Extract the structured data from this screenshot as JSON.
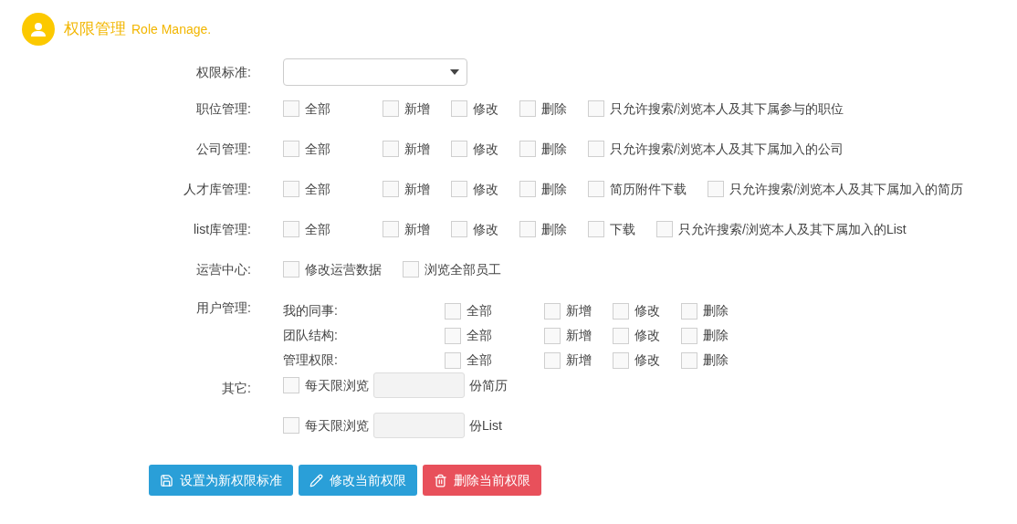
{
  "header": {
    "title": "权限管理",
    "subtitle": "Role Manage."
  },
  "standard": {
    "label": "权限标准:"
  },
  "rows": [
    {
      "kind": "options",
      "label": "职位管理:",
      "options": [
        {
          "label": "全部",
          "checked": false
        },
        {
          "label": "新增",
          "checked": false
        },
        {
          "label": "修改",
          "checked": false
        },
        {
          "label": "删除",
          "checked": false
        },
        {
          "label": "只允许搜索/浏览本人及其下属参与的职位",
          "checked": false
        }
      ]
    },
    {
      "kind": "options",
      "label": "公司管理:",
      "options": [
        {
          "label": "全部",
          "checked": false
        },
        {
          "label": "新增",
          "checked": false
        },
        {
          "label": "修改",
          "checked": false
        },
        {
          "label": "删除",
          "checked": false
        },
        {
          "label": "只允许搜索/浏览本人及其下属加入的公司",
          "checked": false
        }
      ]
    },
    {
      "kind": "options",
      "label": "人才库管理:",
      "options": [
        {
          "label": "全部",
          "checked": false
        },
        {
          "label": "新增",
          "checked": false
        },
        {
          "label": "修改",
          "checked": false
        },
        {
          "label": "删除",
          "checked": false
        },
        {
          "label": "简历附件下载",
          "checked": false
        },
        {
          "label": "只允许搜索/浏览本人及其下属加入的简历",
          "checked": false
        }
      ]
    },
    {
      "kind": "options",
      "label": "list库管理:",
      "options": [
        {
          "label": "全部",
          "checked": false
        },
        {
          "label": "新增",
          "checked": false
        },
        {
          "label": "修改",
          "checked": false
        },
        {
          "label": "删除",
          "checked": false
        },
        {
          "label": "下载",
          "checked": false
        },
        {
          "label": "只允许搜索/浏览本人及其下属加入的List",
          "checked": false
        }
      ]
    },
    {
      "kind": "plain",
      "label": "运营中心:",
      "options": [
        {
          "label": "修改运营数据",
          "checked": false
        },
        {
          "label": "浏览全部员工",
          "checked": false
        }
      ]
    },
    {
      "kind": "nested",
      "label": "用户管理:",
      "groups": [
        {
          "label": "我的同事:",
          "options": [
            {
              "label": "全部",
              "checked": false
            },
            {
              "label": "新增",
              "checked": false
            },
            {
              "label": "修改",
              "checked": false
            },
            {
              "label": "删除",
              "checked": false
            }
          ]
        },
        {
          "label": "团队结构:",
          "options": [
            {
              "label": "全部",
              "checked": false
            },
            {
              "label": "新增",
              "checked": false
            },
            {
              "label": "修改",
              "checked": false
            },
            {
              "label": "删除",
              "checked": false
            }
          ]
        },
        {
          "label": "管理权限:",
          "options": [
            {
              "label": "全部",
              "checked": false
            },
            {
              "label": "新增",
              "checked": false
            },
            {
              "label": "修改",
              "checked": false
            },
            {
              "label": "删除",
              "checked": false
            }
          ]
        }
      ]
    },
    {
      "kind": "limits",
      "label": "其它:",
      "limits": [
        {
          "label": "每天限浏览",
          "unit": "份简历",
          "checked": false
        },
        {
          "label": "每天限浏览",
          "unit": "份List",
          "checked": false
        }
      ]
    }
  ],
  "buttons": [
    {
      "kind": "save",
      "label": "设置为新权限标准"
    },
    {
      "kind": "edit",
      "label": "修改当前权限"
    },
    {
      "kind": "delete",
      "label": "删除当前权限"
    }
  ]
}
